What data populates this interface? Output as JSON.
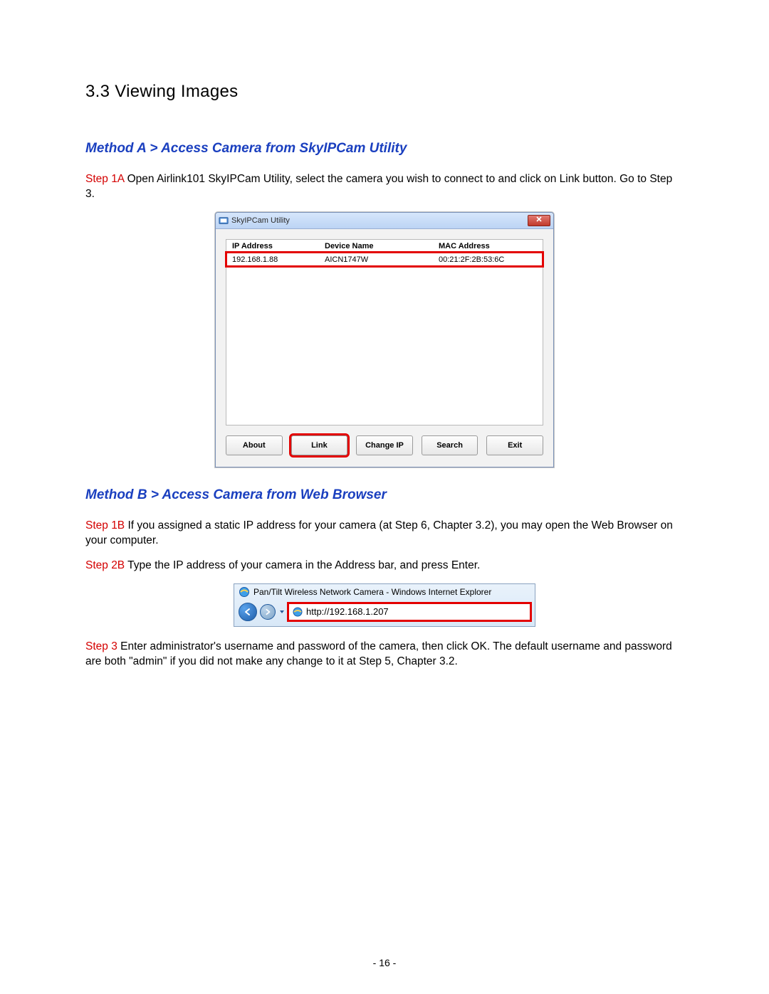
{
  "section_title": "3.3  Viewing Images",
  "method_a": {
    "heading": "Method A > Access Camera from SkyIPCam Utility",
    "step1a_label": "Step 1A",
    "step1a_text": " Open Airlink101 SkyIPCam Utility, select the camera you wish to connect to and click on Link button. Go to Step 3."
  },
  "utility_window": {
    "title": "SkyIPCam Utility",
    "columns": {
      "ip": "IP Address",
      "device": "Device Name",
      "mac": "MAC Address"
    },
    "row": {
      "ip": "192.168.1.88",
      "device": "AICN1747W",
      "mac": "00:21:2F:2B:53:6C"
    },
    "buttons": {
      "about": "About",
      "link": "Link",
      "changeip": "Change IP",
      "search": "Search",
      "exit": "Exit"
    }
  },
  "method_b": {
    "heading": "Method B > Access Camera from Web Browser",
    "step1b_label": "Step 1B",
    "step1b_text": " If you assigned a static IP address for your camera (at Step 6, Chapter 3.2), you may open the Web Browser on your computer.",
    "step2b_label": "Step 2B",
    "step2b_text": " Type the IP address of your camera in the Address bar, and press Enter."
  },
  "ie_bar": {
    "title": "Pan/Tilt Wireless Network Camera - Windows Internet Explorer",
    "url": "http://192.168.1.207"
  },
  "step3": {
    "label": "Step 3",
    "text": " Enter administrator's username and password of the camera, then click OK. The default username and password are both \"admin\" if you did not make any change to it at Step 5, Chapter 3.2."
  },
  "page_number": "- 16 -"
}
